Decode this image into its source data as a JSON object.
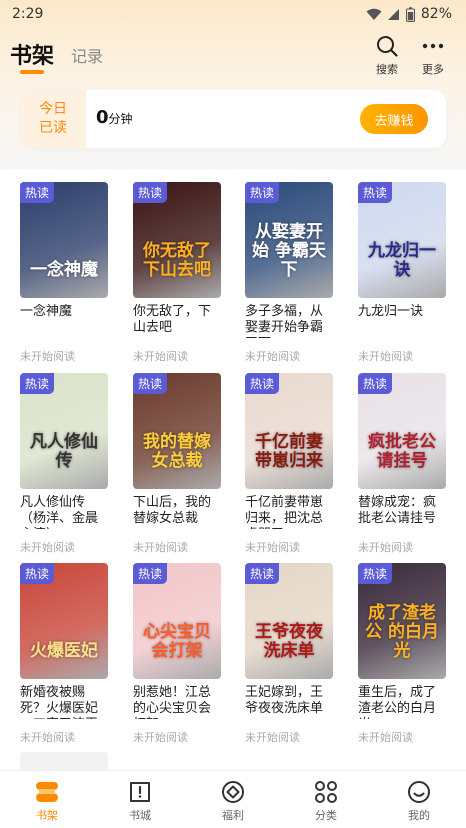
{
  "status": {
    "time": "2:29",
    "battery": "82%"
  },
  "header": {
    "tab_shelf": "书架",
    "tab_record": "记录",
    "search_label": "搜索",
    "more_label": "更多",
    "accent": "#ff8a00"
  },
  "reading": {
    "today_line1": "今日",
    "today_line2": "已读",
    "minutes": "0",
    "unit": "分钟",
    "earn_button": "去赚钱"
  },
  "books": [
    {
      "tag": "热读",
      "title": "一念神魔",
      "status": "未开始阅读",
      "cover_text": "一念神魔",
      "cover_bg": "#2c3e6b",
      "cover_fg": "#ffffff"
    },
    {
      "tag": "热读",
      "title": "你无敌了，下山去吧",
      "status": "未开始阅读",
      "cover_text": "你无敌了 下山去吧",
      "cover_bg": "#3a1414",
      "cover_fg": "#ffb020"
    },
    {
      "tag": "热读",
      "title": "多子多福，从娶妻开始争霸天下",
      "status": "未开始阅读",
      "cover_text": "从娶妻开始 争霸天下",
      "cover_bg": "#2b4a7a",
      "cover_fg": "#ffffff"
    },
    {
      "tag": "热读",
      "title": "九龙归一诀",
      "status": "未开始阅读",
      "cover_text": "九龙归一诀",
      "cover_bg": "#cfd8ee",
      "cover_fg": "#2a2a8a"
    },
    {
      "tag": "热读",
      "title": "凡人修仙传（杨洋、金晨主演）",
      "status": "未开始阅读",
      "cover_text": "凡人修仙传",
      "cover_bg": "#d9e2c9",
      "cover_fg": "#333333"
    },
    {
      "tag": "热读",
      "title": "下山后，我的替嫁女总裁",
      "status": "未开始阅读",
      "cover_text": "我的替嫁 女总裁",
      "cover_bg": "#6a3a2a",
      "cover_fg": "#ffcf3a"
    },
    {
      "tag": "热读",
      "title": "千亿前妻带崽归来，把沈总虐哭了",
      "status": "未开始阅读",
      "cover_text": "千亿前妻 带崽归来",
      "cover_bg": "#e9d9cf",
      "cover_fg": "#8a1a10"
    },
    {
      "tag": "热读",
      "title": "替嫁成宠：疯批老公请挂号",
      "status": "未开始阅读",
      "cover_text": "疯批老公 请挂号",
      "cover_bg": "#e8e2e6",
      "cover_fg": "#b02030"
    },
    {
      "tag": "热读",
      "title": "新婚夜被赐死？火爆医妃一刀宰了渣王",
      "status": "未开始阅读",
      "cover_text": "火爆医妃",
      "cover_bg": "#c8463a",
      "cover_fg": "#ffe08a"
    },
    {
      "tag": "热读",
      "title": "别惹她！江总的心尖宝贝会打架",
      "status": "未开始阅读",
      "cover_text": "心尖宝贝 会打架",
      "cover_bg": "#f2c6c9",
      "cover_fg": "#ff5a2a"
    },
    {
      "tag": "热读",
      "title": "王妃嫁到，王爷夜夜洗床单",
      "status": "未开始阅读",
      "cover_text": "王爷夜夜 洗床单",
      "cover_bg": "#e5d6c6",
      "cover_fg": "#b01818"
    },
    {
      "tag": "热读",
      "title": "重生后，成了渣老公的白月光",
      "status": "未开始阅读",
      "cover_text": "成了渣老公 的白月光",
      "cover_bg": "#3a2a3a",
      "cover_fg": "#ffb020"
    }
  ],
  "nav": [
    {
      "label": "书架"
    },
    {
      "label": "书城"
    },
    {
      "label": "福利"
    },
    {
      "label": "分类"
    },
    {
      "label": "我的"
    }
  ]
}
